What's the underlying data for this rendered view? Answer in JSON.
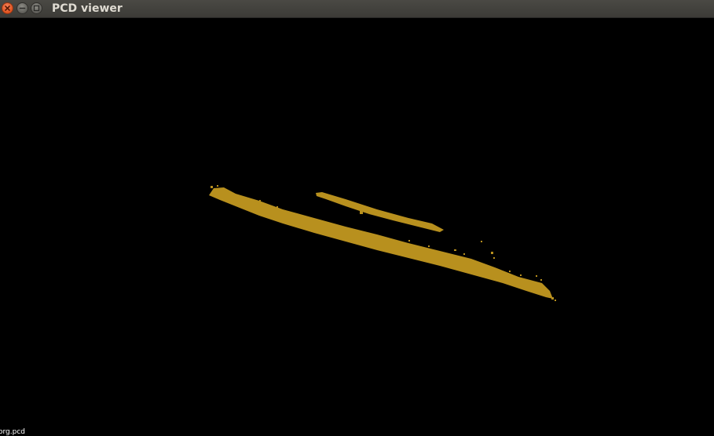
{
  "window": {
    "title": "PCD viewer",
    "buttons": {
      "close_icon": "close-icon",
      "minimize_icon": "minimize-icon",
      "maximize_icon": "maximize-icon"
    }
  },
  "viewer": {
    "background_color": "#000000",
    "point_color": "#b8901e",
    "filename": "org.pcd"
  }
}
